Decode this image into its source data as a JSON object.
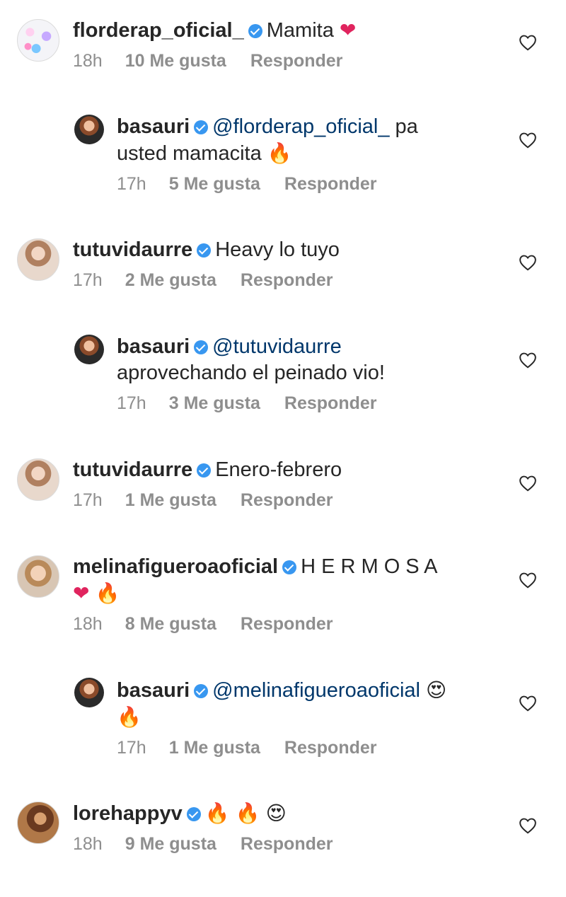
{
  "meta_labels": {
    "reply": "Responder"
  },
  "comments": [
    {
      "username": "florderap_oficial_",
      "verified": true,
      "text": "Mamita",
      "emoji": "❤",
      "time": "18h",
      "likes": "10 Me gusta",
      "avatar": "butterflies-avatar",
      "is_reply": false
    },
    {
      "username": "basauri",
      "verified": true,
      "mention": "@florderap_oficial_",
      "text": "pa",
      "text2": "usted mamacita",
      "emoji": "🔥",
      "time": "17h",
      "likes": "5 Me gusta",
      "avatar": "basauri-avatar",
      "is_reply": true
    },
    {
      "username": "tutuvidaurre",
      "verified": true,
      "text": "Heavy lo tuyo",
      "time": "17h",
      "likes": "2 Me gusta",
      "avatar": "tutuvidaurre-avatar",
      "is_reply": false
    },
    {
      "username": "basauri",
      "verified": true,
      "mention": "@tutuvidaurre",
      "text2": "aprovechando el peinado vio!",
      "time": "17h",
      "likes": "3 Me gusta",
      "avatar": "basauri-avatar",
      "is_reply": true
    },
    {
      "username": "tutuvidaurre",
      "verified": true,
      "text": "Enero-febrero",
      "time": "17h",
      "likes": "1 Me gusta",
      "avatar": "tutuvidaurre-avatar",
      "is_reply": false
    },
    {
      "username": "melinafigueroaoficial",
      "verified": true,
      "text": "H E R M O S A",
      "emoji_line2": [
        "❤",
        "🔥"
      ],
      "time": "18h",
      "likes": "8 Me gusta",
      "avatar": "melinafigueroa-avatar",
      "is_reply": false
    },
    {
      "username": "basauri",
      "verified": true,
      "mention": "@melinafigueroaoficial",
      "emoji": "😍",
      "emoji_line2": [
        "🔥"
      ],
      "time": "17h",
      "likes": "1 Me gusta",
      "avatar": "basauri-avatar",
      "is_reply": true
    },
    {
      "username": "lorehappyv",
      "verified": true,
      "emojis": [
        "🔥",
        "🔥",
        "😍"
      ],
      "time": "18h",
      "likes": "9 Me gusta",
      "avatar": "lorehappyv-avatar",
      "is_reply": false
    }
  ],
  "icons": {
    "like": "heart-outline-icon",
    "verified": "verified-badge-icon"
  },
  "colors": {
    "verified": "#3897f0",
    "mention": "#00376b",
    "meta": "#8e8e8e",
    "text": "#262626"
  }
}
